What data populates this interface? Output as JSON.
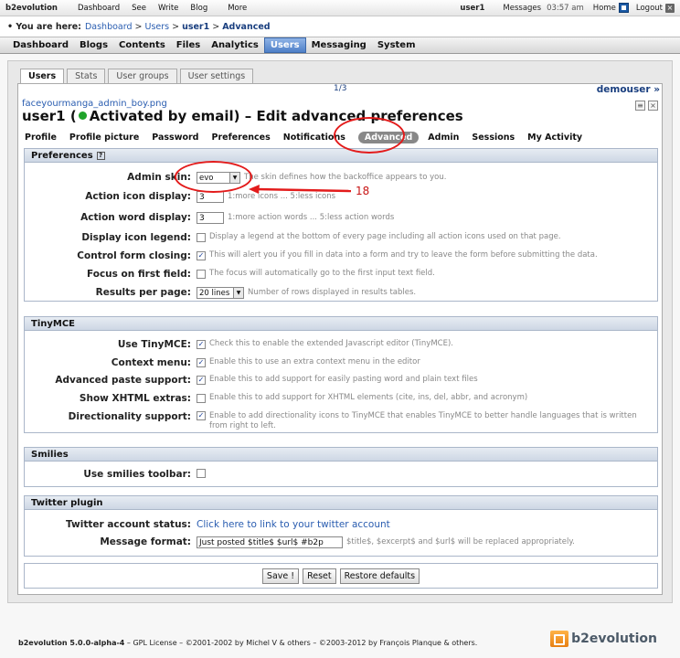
{
  "topbar": {
    "brand": "b2evolution",
    "links": [
      "Dashboard",
      "See",
      "Write",
      "Blog",
      "More"
    ],
    "user": "user1",
    "messages": "Messages",
    "time": "03:57 am",
    "home": "Home",
    "logout": "Logout"
  },
  "breadcrumb": {
    "lead": "• You are here:",
    "items": [
      "Dashboard",
      "Users",
      "user1"
    ],
    "current": "Advanced"
  },
  "mainmenu": {
    "items": [
      "Dashboard",
      "Blogs",
      "Contents",
      "Files",
      "Analytics",
      "Users",
      "Messaging",
      "System"
    ],
    "active": "Users"
  },
  "subtabs": [
    "Users",
    "Stats",
    "User groups",
    "User settings"
  ],
  "pager": "1/3",
  "next_user": "demouser »",
  "image_name": "faceyourmanga_admin_boy.png",
  "title": {
    "user": "user1",
    "status_prefix": "(",
    "status": "Activated by email)",
    "suffix": "– Edit advanced preferences"
  },
  "edit_tabs": [
    "Profile",
    "Profile picture",
    "Password",
    "Preferences",
    "Notifications",
    "Advanced",
    "Admin",
    "Sessions",
    "My Activity"
  ],
  "sections": {
    "preferences": {
      "legend": "Preferences",
      "admin_skin": {
        "label": "Admin skin:",
        "value": "evo",
        "note": "The skin defines how the backoffice appears to you."
      },
      "action_icon": {
        "label": "Action icon display:",
        "value": "3",
        "note": "1:more icons ... 5:less icons"
      },
      "action_word": {
        "label": "Action word display:",
        "value": "3",
        "note": "1:more action words ... 5:less action words"
      },
      "icon_legend": {
        "label": "Display icon legend:",
        "note": "Display a legend at the bottom of every page including all action icons used on that page."
      },
      "control_form": {
        "label": "Control form closing:",
        "note": "This will alert you if you fill in data into a form and try to leave the form before submitting the data."
      },
      "focus_first": {
        "label": "Focus on first field:",
        "note": "The focus will automatically go to the first input text field."
      },
      "results_page": {
        "label": "Results per page:",
        "value": "20 lines",
        "note": "Number of rows displayed in results tables."
      }
    },
    "tinymce": {
      "legend": "TinyMCE",
      "use": {
        "label": "Use TinyMCE:",
        "note": "Check this to enable the extended Javascript editor (TinyMCE)."
      },
      "context": {
        "label": "Context menu:",
        "note": "Enable this to use an extra context menu in the editor"
      },
      "paste": {
        "label": "Advanced paste support:",
        "note": "Enable this to add support for easily pasting word and plain text files"
      },
      "xhtml": {
        "label": "Show XHTML extras:",
        "note": "Enable this to add support for XHTML elements (cite, ins, del, abbr, and acronym)"
      },
      "direction": {
        "label": "Directionality support:",
        "note": "Enable to add directionality icons to TinyMCE that enables TinyMCE to better handle languages that is written from right to left."
      }
    },
    "smilies": {
      "legend": "Smilies",
      "toolbar": {
        "label": "Use smilies toolbar:"
      }
    },
    "twitter": {
      "legend": "Twitter plugin",
      "status": {
        "label": "Twitter account status:",
        "link": "Click here to link to your twitter account"
      },
      "format": {
        "label": "Message format:",
        "value": "Just posted $title$ $url$ #b2p",
        "note": "$title$, $excerpt$ and $url$ will be replaced appropriately."
      }
    }
  },
  "buttons": {
    "save": "Save !",
    "reset": "Reset",
    "restore": "Restore defaults"
  },
  "annotation": {
    "label": "18",
    "color": "#e31b1b"
  },
  "footer": {
    "version": "b2evolution 5.0.0-alpha-4",
    "text": " – GPL License – ©2001-2002 by Michel V & others – ©2003-2012 by François Planque & others.",
    "logo": "b2evolution"
  }
}
